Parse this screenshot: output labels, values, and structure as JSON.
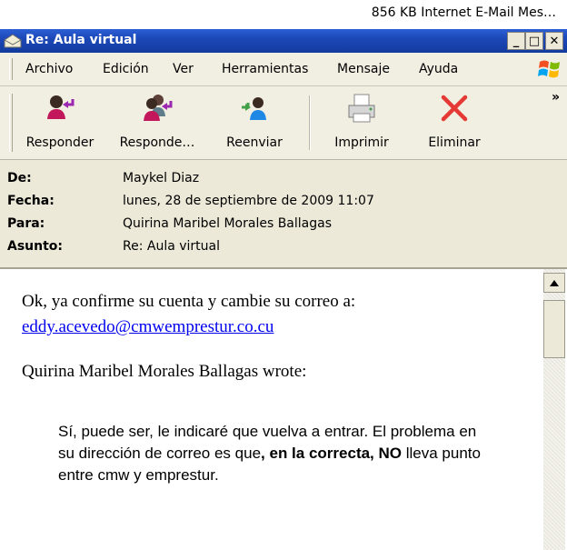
{
  "top_info": "856 KB   Internet E-Mail Mes…",
  "window": {
    "title": "Re: Aula virtual"
  },
  "controls": {
    "minimize": "_",
    "maximize": "□",
    "close": "✕"
  },
  "menu": [
    "Archivo",
    "Edición",
    "Ver",
    "Herramientas",
    "Mensaje",
    "Ayuda"
  ],
  "toolbar": {
    "reply": "Responder",
    "reply_all": "Responde…",
    "forward": "Reenviar",
    "print": "Imprimir",
    "delete": "Eliminar",
    "more": "»"
  },
  "headers": {
    "from_label": "De:",
    "from": "Maykel Diaz",
    "date_label": "Fecha:",
    "date": "lunes, 28 de septiembre de 2009 11:07",
    "to_label": "Para:",
    "to": "Quirina Maribel Morales Ballagas",
    "subject_label": "Asunto:",
    "subject": "Re: Aula virtual"
  },
  "message": {
    "line1": "Ok, ya confirme su cuenta y cambie su correo a:",
    "email": "eddy.acevedo@cmwemprestur.co.cu",
    "wrote": "Quirina Maribel Morales Ballagas wrote:",
    "quote_a": "Sí,  puede ser, le indicaré que vuelva a entrar. El problema en su dirección de correo es que",
    "quote_comma": ",",
    "quote_bold": "en la correcta, NO",
    "quote_b": " lleva punto entre cmw y emprestur."
  }
}
